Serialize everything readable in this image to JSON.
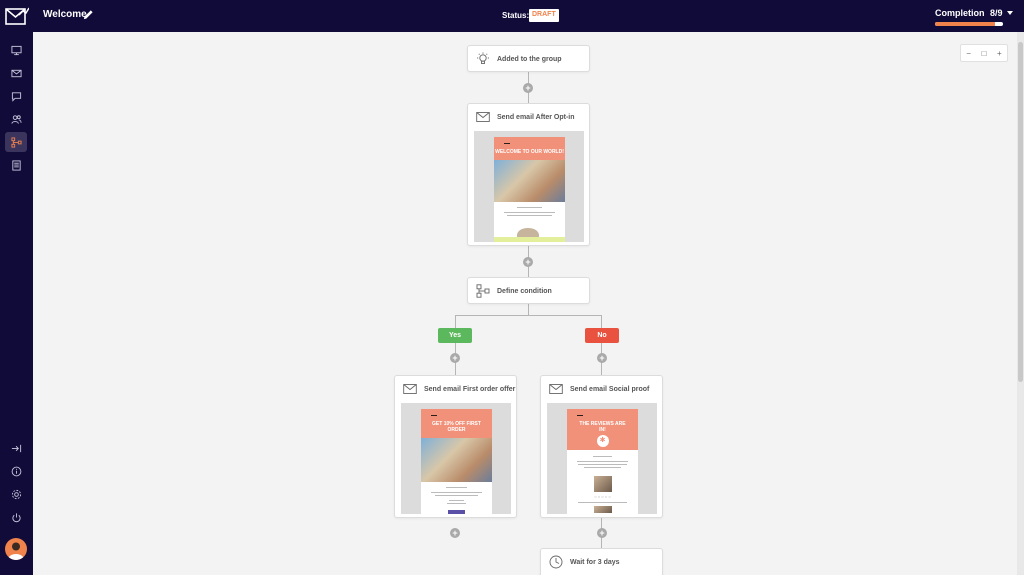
{
  "header": {
    "title": "Welcome",
    "status_label": "Status:",
    "status_value": "DRAFT",
    "completion_label": "Completion",
    "completion_value": "8/9",
    "completion_fraction": 0.889,
    "accent_color": "#f0824c",
    "bar_color": "#110b3a"
  },
  "sidebar": {
    "items": [
      {
        "icon": "monitor-icon"
      },
      {
        "icon": "mail-icon"
      },
      {
        "icon": "chat-icon"
      },
      {
        "icon": "users-icon"
      },
      {
        "icon": "workflow-icon",
        "active": true
      },
      {
        "icon": "document-icon"
      }
    ],
    "bottom": [
      {
        "icon": "collapse-icon"
      },
      {
        "icon": "info-icon"
      },
      {
        "icon": "gear-icon"
      },
      {
        "icon": "power-icon"
      }
    ]
  },
  "zoom": {
    "minus": "−",
    "reset": "□",
    "plus": "+"
  },
  "flow": {
    "trigger": {
      "label": "Added to the group"
    },
    "email1": {
      "label": "Send email After Opt-in",
      "headline": "WELCOME TO OUR WORLD!"
    },
    "condition": {
      "label": "Define condition"
    },
    "yes": "Yes",
    "no": "No",
    "email_yes": {
      "label": "Send email First order offer",
      "headline": "GET 10% OFF FIRST ORDER"
    },
    "email_no": {
      "label": "Send email Social proof",
      "headline": "THE REVIEWS ARE IN!"
    },
    "wait": {
      "label": "Wait for 3 days"
    },
    "plus": "+"
  }
}
